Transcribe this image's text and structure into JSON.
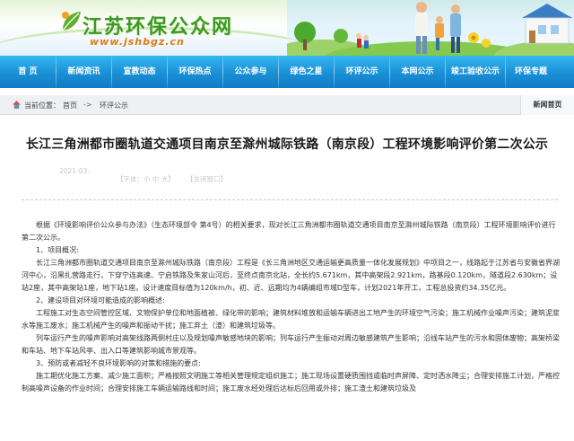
{
  "header": {
    "logo_cn": "江苏环保公众网",
    "logo_url": "www.jshbgz.cn"
  },
  "nav": {
    "items": [
      {
        "label": "首  页"
      },
      {
        "label": "新闻资讯"
      },
      {
        "label": "宣教动态"
      },
      {
        "label": "环保热点"
      },
      {
        "label": "公众参与"
      },
      {
        "label": "绿色之星"
      },
      {
        "label": "环评公示"
      },
      {
        "label": "本网公示"
      },
      {
        "label": "竣工验收公示"
      },
      {
        "label": "环保专题"
      }
    ]
  },
  "breadcrumb": {
    "label": "当前位置：",
    "home": "首页",
    "arrow": "->",
    "current": "环评公示",
    "tab": "新闻首页"
  },
  "article": {
    "title": "长江三角洲都市圈轨道交通项目南京至滁州城际铁路（南京段）工程环境影响评价第二次公示",
    "date": "2021-03-",
    "font_sizes": "【字体：小 中 大】",
    "close": "【关闭窗口】",
    "paragraphs": [
      "根据《环境影响评价公众参与办法》（生态环境部令 第4号）的相关要求，现对长江三角洲都市圈轨道交通项目南京至滁州城际铁路（南京段）工程环境影响评价进行第二次公示。",
      "1、项目概况:",
      "长江三角洲都市圈轨道交通项目南京至滁州城际铁路（南京段）工程是《长三角洲地区交通运输更高质量一体化发展规划》中项目之一，线路起于江苏省与安徽省界湖河中心，沿黑扎营路走行，下穿宁连高速、宁启铁路及朱家山河后，至终点南京北站，全长约5.671km，其中高架段2.921km，路基段0.120km，隧道段2.630km；设站2座，其中高架站1座，地下站1座。设计速度目标值为120km/h，初、近、远期均为4辆编组市域D型车，计划2021年开工，工程总投资约34.35亿元。",
      "2、建设项目对环境可能造成的影响概述:",
      "工程施工对生态空间管控区域、文物保护单位和地面植被、绿化带的影响；建筑材料堆放和运输车辆进出工地产生的环境空气污染；施工机械作业噪声污染；建筑泥浆水等施工废水；施工机械产生的噪声和振动干扰；施工弃土（渣）和建筑垃圾等。",
      "列车运行产生的噪声影响对高架线路两侧村庄以及规划噪声敏感地块的影响；列车运行产生振动对周边敏感建筑产生影响；沿线车站产生的污水和固体废物；高架桥梁和车站、地下车站风亭、出入口等建筑影响城市景观等。",
      "3、预防或者减轻不良环境影响的对策和措施的要点:",
      "施工期优化施工方案、减少施工面积；严格按照文明施工等相关管理规定组织施工；施工现场设置硬质围挡或临时声屏障、定时洒水降尘；合理安排施工计划，严格控制高噪声设备的作业时间；合理安排施工车辆运输路线和时间；施工废水经处理后达标后回用或外排；施工渣土和建筑垃圾及"
    ]
  }
}
